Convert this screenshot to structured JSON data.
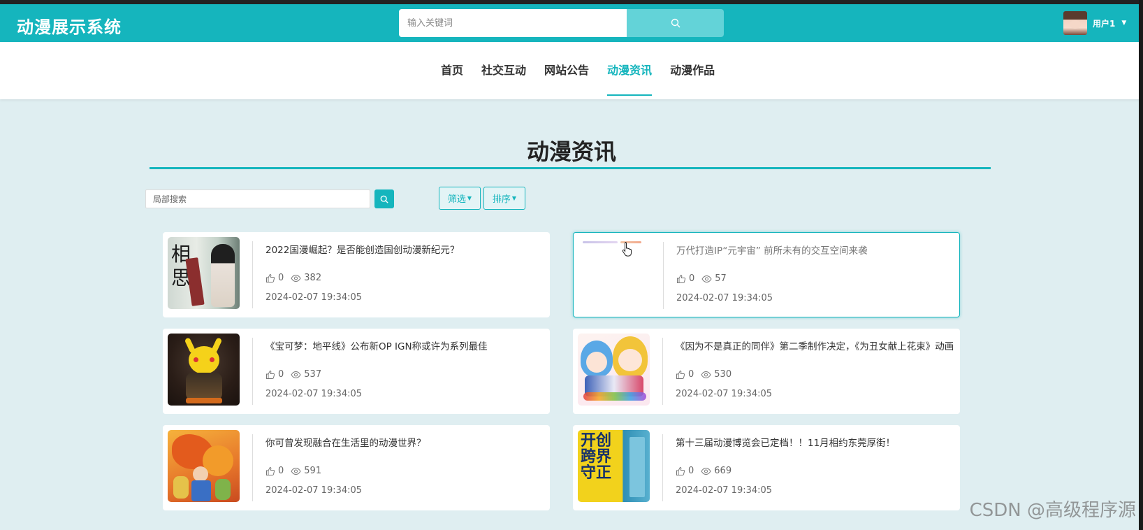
{
  "header": {
    "logo": "动漫展示系统",
    "search_placeholder": "输入关键词",
    "username": "用户1"
  },
  "nav": {
    "items": [
      {
        "label": "首页",
        "active": false
      },
      {
        "label": "社交互动",
        "active": false
      },
      {
        "label": "网站公告",
        "active": false
      },
      {
        "label": "动漫资讯",
        "active": true
      },
      {
        "label": "动漫作品",
        "active": false
      }
    ]
  },
  "page": {
    "title": "动漫资讯",
    "local_search_placeholder": "局部搜索",
    "filter_label": "筛选",
    "sort_label": "排序"
  },
  "cards": [
    {
      "title": "2022国漫崛起？是否能创造国创动漫新纪元？",
      "likes": "0",
      "views": "382",
      "date": "2024-02-07 19:34:05"
    },
    {
      "title": "万代打造IP“元宇宙” 前所未有的交互空间来袭",
      "likes": "0",
      "views": "57",
      "date": "2024-02-07 19:34:05"
    },
    {
      "title": "《宝可梦：地平线》公布新OP IGN称或许为系列最佳",
      "likes": "0",
      "views": "537",
      "date": "2024-02-07 19:34:05"
    },
    {
      "title": "《因为不是真正的同伴》第二季制作决定，《为丑女献上花束》动画",
      "likes": "0",
      "views": "530",
      "date": "2024-02-07 19:34:05"
    },
    {
      "title": "你可曾发现融合在生活里的动漫世界？",
      "likes": "0",
      "views": "591",
      "date": "2024-02-07 19:34:05"
    },
    {
      "title": "第十三届动漫博览会已定档！！11月相约东莞厚街！",
      "likes": "0",
      "views": "669",
      "date": "2024-02-07 19:34:05"
    }
  ],
  "thumbs": {
    "card1_text": "相思",
    "card6_text": "开创跨界守正"
  },
  "watermark": "CSDN @高级程序源",
  "colors": {
    "accent": "#15b5bd",
    "accent_light": "#63d3d8",
    "background": "#dfeef1"
  }
}
